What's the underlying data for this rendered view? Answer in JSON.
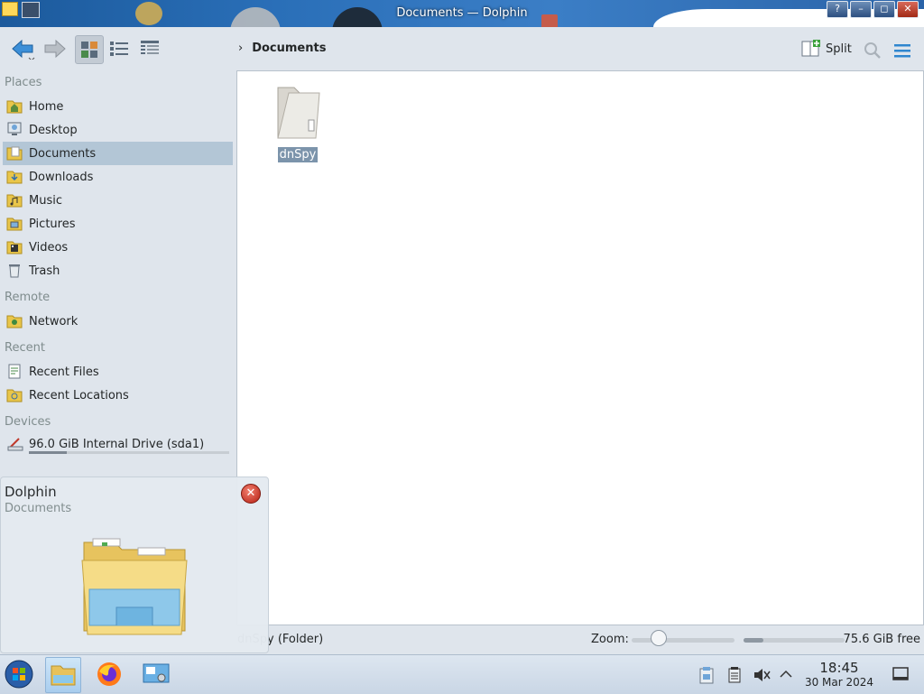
{
  "window": {
    "title": "Documents — Dolphin"
  },
  "toolbar": {
    "back_icon": "back-arrow-icon",
    "forward_icon": "forward-arrow-icon",
    "view_modes": [
      "icons-view-icon",
      "compact-view-icon",
      "details-view-icon"
    ],
    "breadcrumb": [
      "Documents"
    ],
    "split_label": "Split",
    "search_icon": "search-icon",
    "menu_icon": "hamburger-menu-icon"
  },
  "sidebar": {
    "sections": [
      {
        "title": "Places",
        "items": [
          {
            "label": "Home",
            "icon": "home-folder-icon"
          },
          {
            "label": "Desktop",
            "icon": "desktop-icon"
          },
          {
            "label": "Documents",
            "icon": "documents-folder-icon",
            "selected": true
          },
          {
            "label": "Downloads",
            "icon": "downloads-folder-icon"
          },
          {
            "label": "Music",
            "icon": "music-folder-icon"
          },
          {
            "label": "Pictures",
            "icon": "pictures-folder-icon"
          },
          {
            "label": "Videos",
            "icon": "videos-folder-icon"
          },
          {
            "label": "Trash",
            "icon": "trash-icon"
          }
        ]
      },
      {
        "title": "Remote",
        "items": [
          {
            "label": "Network",
            "icon": "network-folder-icon"
          }
        ]
      },
      {
        "title": "Recent",
        "items": [
          {
            "label": "Recent Files",
            "icon": "recent-files-icon"
          },
          {
            "label": "Recent Locations",
            "icon": "recent-locations-icon"
          }
        ]
      },
      {
        "title": "Devices",
        "items": [
          {
            "label": "96.0 GiB Internal Drive (sda1)",
            "icon": "drive-icon",
            "used_fraction": 0.19
          }
        ]
      }
    ]
  },
  "files": [
    {
      "name": "dnSpy",
      "type": "folder",
      "selected": true
    }
  ],
  "statusbar": {
    "text": "dnSpy (Folder)",
    "zoom_label": "Zoom:",
    "zoom_fraction": 0.25,
    "free_text": "75.6 GiB free",
    "disk_used_fraction": 0.2
  },
  "tooltip": {
    "app": "Dolphin",
    "subtitle": "Documents",
    "close_icon": "close-icon",
    "preview_icon": "file-explorer-folder-icon"
  },
  "taskbar": {
    "start_icon": "start-orb-icon",
    "apps": [
      "file-manager-icon",
      "firefox-icon",
      "system-settings-icon"
    ],
    "tray_icons": [
      "clipboard-icon",
      "notes-icon",
      "volume-muted-icon",
      "tray-expand-icon"
    ],
    "time": "18:45",
    "date": "30 Mar 2024",
    "show_desktop_icon": "show-desktop-icon"
  },
  "colors": {
    "accent": "#3daee9",
    "selection": "#b3c6d6",
    "titlebar": "#2a6fb8"
  }
}
